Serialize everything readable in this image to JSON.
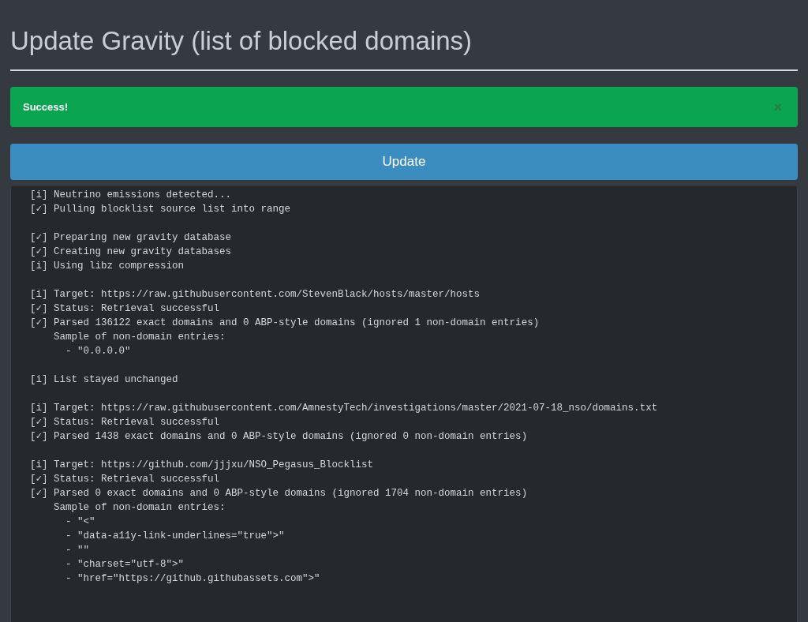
{
  "page": {
    "title": "Update Gravity (list of blocked domains)"
  },
  "alert": {
    "kind": "success",
    "message": "Success!",
    "close": "×"
  },
  "update_button": {
    "label": "Update"
  },
  "log": {
    "blocks": [
      {
        "lines": [
          {
            "tag": "[i]",
            "text": "Neutrino emissions detected..."
          },
          {
            "tag": "[✓]",
            "text": "Pulling blocklist source list into range"
          }
        ]
      },
      {
        "lines": [
          {
            "tag": "[✓]",
            "text": "Preparing new gravity database"
          },
          {
            "tag": "[✓]",
            "text": "Creating new gravity databases"
          },
          {
            "tag": "[i]",
            "text": "Using libz compression"
          }
        ]
      },
      {
        "lines": [
          {
            "tag": "[i]",
            "text": "Target: https://raw.githubusercontent.com/StevenBlack/hosts/master/hosts"
          },
          {
            "tag": "[✓]",
            "text": "Status: Retrieval successful"
          },
          {
            "tag": "[✓]",
            "text": "Parsed 136122 exact domains and 0 ABP-style domains (ignored 1 non-domain entries)",
            "children": [
              {
                "text": "Sample of non-domain entries:",
                "children": [
                  {
                    "text": "- \"0.0.0.0\""
                  }
                ]
              }
            ]
          }
        ]
      },
      {
        "lines": [
          {
            "tag": "[i]",
            "text": "List stayed unchanged"
          }
        ]
      },
      {
        "lines": [
          {
            "tag": "[i]",
            "text": "Target: https://raw.githubusercontent.com/AmnestyTech/investigations/master/2021-07-18_nso/domains.txt"
          },
          {
            "tag": "[✓]",
            "text": "Status: Retrieval successful"
          },
          {
            "tag": "[✓]",
            "text": "Parsed 1438 exact domains and 0 ABP-style domains (ignored 0 non-domain entries)"
          }
        ]
      },
      {
        "lines": [
          {
            "tag": "[i]",
            "text": "Target: https://github.com/jjjxu/NSO_Pegasus_Blocklist"
          },
          {
            "tag": "[✓]",
            "text": "Status: Retrieval successful"
          },
          {
            "tag": "[✓]",
            "text": "Parsed 0 exact domains and 0 ABP-style domains (ignored 1704 non-domain entries)",
            "children": [
              {
                "text": "Sample of non-domain entries:",
                "children": [
                  {
                    "text": "- \"<\""
                  },
                  {
                    "text": "- \"data-a11y-link-underlines=\"true\">\""
                  },
                  {
                    "text": "- \"\""
                  },
                  {
                    "text": "- \"charset=\"utf-8\">\""
                  },
                  {
                    "text": "- \"href=\"https://github.githubassets.com\">\""
                  }
                ]
              }
            ]
          }
        ]
      }
    ]
  }
}
